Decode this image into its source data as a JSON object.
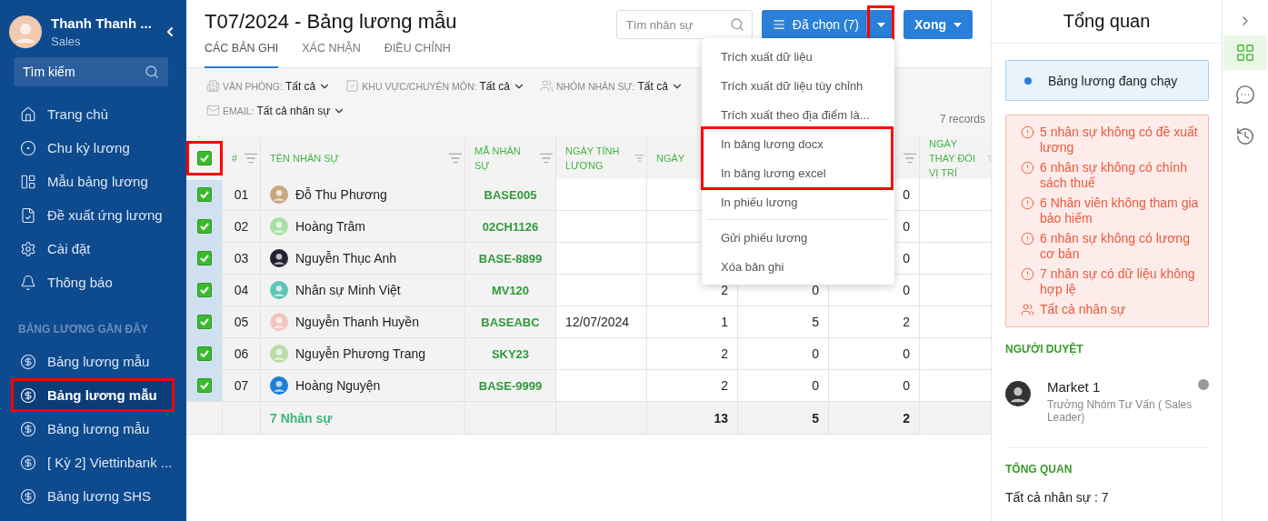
{
  "sidebar": {
    "user": {
      "name": "Thanh Thanh ...",
      "role": "Sales"
    },
    "search": {
      "placeholder": "Tìm kiếm"
    },
    "nav": [
      {
        "label": "Trang chủ",
        "selected": false
      },
      {
        "label": "Chu kỳ lương",
        "selected": false
      },
      {
        "label": "Mẫu bảng lương",
        "selected": false
      },
      {
        "label": "Đề xuất ứng lương",
        "selected": false
      },
      {
        "label": "Cài đặt",
        "selected": false
      },
      {
        "label": "Thông báo",
        "selected": false
      }
    ],
    "recent_title": "BẢNG LƯƠNG GẦN ĐÂY",
    "recent": [
      {
        "label": "Bảng lương mẫu",
        "selected": false,
        "highlighted": false
      },
      {
        "label": "Bảng lương mẫu",
        "selected": true,
        "highlighted": true
      },
      {
        "label": "Bảng lương mẫu",
        "selected": false,
        "highlighted": false
      },
      {
        "label": "[ Kỳ 2] Viettinbank ...",
        "selected": false,
        "highlighted": false
      },
      {
        "label": "Bảng lương SHS",
        "selected": false,
        "highlighted": false
      }
    ]
  },
  "header": {
    "title": "T07/2024 - Bảng lương mẫu",
    "search": {
      "placeholder": "Tìm nhân sự"
    },
    "selected_button": {
      "label": "Đã chọn (7)",
      "caret_highlighted": true
    },
    "done_button": {
      "label": "Xong"
    }
  },
  "tabs": [
    {
      "label": "CÁC BẢN GHI",
      "selected": true
    },
    {
      "label": "XÁC NHẬN",
      "selected": false
    },
    {
      "label": "ĐIỀU CHỈNH",
      "selected": false
    }
  ],
  "filters": [
    {
      "label": "VĂN PHÒNG:",
      "value": "Tất cả"
    },
    {
      "label": "KHU VỰC/CHUYÊN MÔN:",
      "value": "Tất cả"
    },
    {
      "label": "NHÓM NHÂN SỰ:",
      "value": "Tất cả"
    },
    {
      "label": "EMAIL:",
      "value": "Tất cả nhân sự"
    }
  ],
  "records": "7 records",
  "table": {
    "header_checkbox": {
      "checked": true,
      "highlighted": true
    },
    "columns": [
      {
        "label": "#",
        "filter": true
      },
      {
        "label": "TÊN NHÂN SỰ",
        "filter": true
      },
      {
        "label": "MÃ NHÂN SỰ",
        "filter": true
      },
      {
        "label": "NGÀY TÍNH LƯƠNG",
        "filter": true
      },
      {
        "label": "NGÀY"
      },
      {},
      {
        "filter": true
      },
      {
        "label": "NGÀY THAY ĐỔI VỊ TRÍ",
        "filter": true
      }
    ],
    "rows": [
      {
        "checked": true,
        "index": "01",
        "name": "Đỗ Thu Phương",
        "code": "BASE005",
        "column_8": "0"
      },
      {
        "checked": true,
        "index": "02",
        "name": "Hoàng Trâm",
        "code": "02CH1126",
        "column_8": "0"
      },
      {
        "checked": true,
        "index": "03",
        "name": "Nguyễn Thục Anh",
        "code": "BASE-8899",
        "column_8": "0"
      },
      {
        "checked": true,
        "index": "04",
        "name": "Nhân sự Minh Việt",
        "code": "MV120",
        "day": "2",
        "column_7": "0",
        "column_8": "0"
      },
      {
        "checked": true,
        "index": "05",
        "name": "Nguyễn Thanh Huyền",
        "code": "BASEABC",
        "date": "12/07/2024",
        "day": "1",
        "column_7": "5",
        "column_8": "2"
      },
      {
        "checked": true,
        "index": "06",
        "name": "Nguyễn Phương Trang",
        "code": "SKY23",
        "day": "2",
        "column_7": "0",
        "column_8": "0"
      },
      {
        "checked": true,
        "index": "07",
        "name": "Hoàng Nguyện",
        "code": "BASE-9999",
        "day": "2",
        "column_7": "0",
        "column_8": "0"
      }
    ],
    "footer": {
      "label": "7 Nhân sự",
      "totals": [
        "13",
        "5",
        "2"
      ]
    }
  },
  "menu": {
    "sections": [
      {
        "separated": false,
        "highlighted": false,
        "items": [
          "Trích xuất dữ liệu",
          "Trích xuất dữ liệu tùy chỉnh",
          "Trích xuất theo địa điểm là..."
        ]
      },
      {
        "separated": false,
        "highlighted": true,
        "items": [
          "In bảng lương docx",
          "In bảng lương excel"
        ]
      },
      {
        "separated": false,
        "highlighted": false,
        "items": [
          "In phiếu lương"
        ]
      },
      {
        "separated": true,
        "highlighted": false,
        "items": [
          "Gửi phiếu lương",
          "Xóa bản ghi"
        ]
      }
    ]
  },
  "overview": {
    "title": "Tổng quan",
    "status": "Bảng lương đang chạy",
    "warnings": [
      {
        "kind": "alert",
        "text": "5 nhân sự không có đề xuất lương"
      },
      {
        "kind": "alert",
        "text": "6 nhân sự không có chính sách thuế"
      },
      {
        "kind": "alert",
        "text": "6 Nhân viên không tham gia bảo hiểm"
      },
      {
        "kind": "alert",
        "text": "6 nhân sự không có lương cơ bản"
      },
      {
        "kind": "alert",
        "text": "7 nhân sự có dữ liệu không hợp lệ"
      },
      {
        "kind": "people",
        "text": "Tất cả nhân sự"
      }
    ],
    "reviewer_title": "NGƯỜI DUYỆT",
    "reviewer": {
      "name": "Market 1",
      "role": "Trưởng Nhóm Tư Vấn ( Sales Leader)",
      "online": false
    },
    "summary_title": "TỔNG QUAN",
    "summary": "Tất cả nhân sự : 7"
  },
  "rail": [
    {
      "selected": true
    },
    {
      "selected": false
    },
    {
      "selected": false
    }
  ]
}
